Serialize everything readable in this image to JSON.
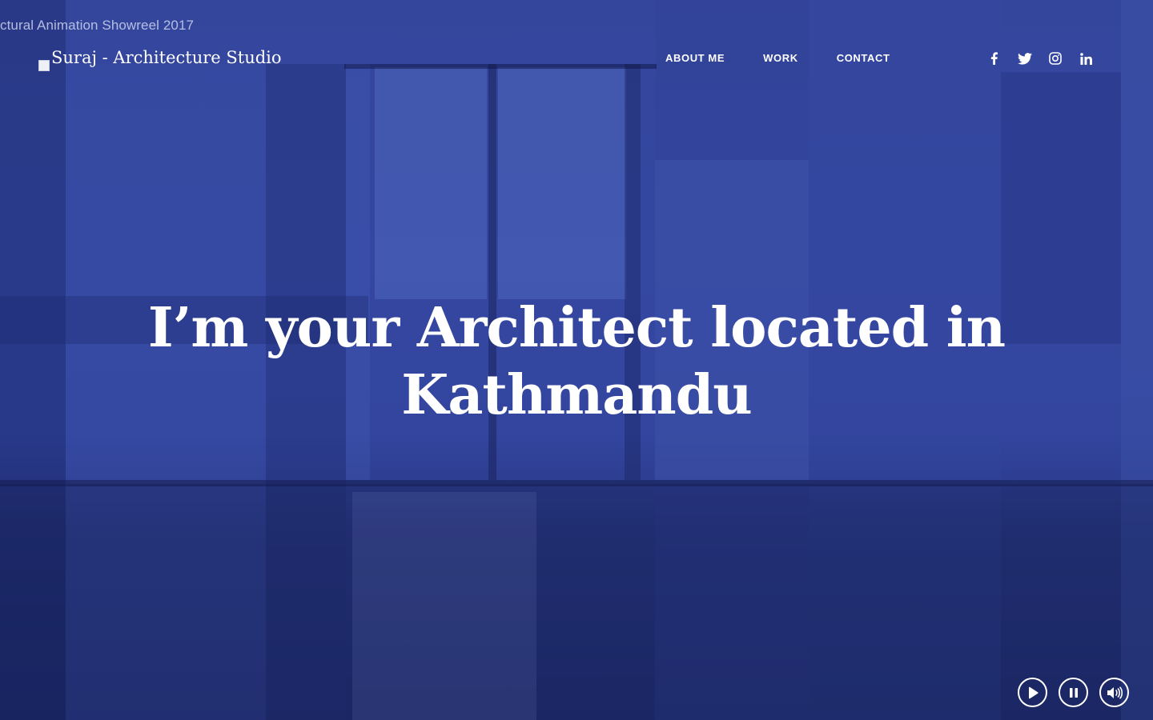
{
  "video": {
    "title": "ctural Animation Showreel 2017"
  },
  "header": {
    "logo_alt": "Suraj - Architecture Studio",
    "nav": [
      {
        "label": "ABOUT ME"
      },
      {
        "label": "WORK"
      },
      {
        "label": "CONTACT"
      }
    ],
    "social": [
      {
        "icon": "facebook-icon"
      },
      {
        "icon": "twitter-icon"
      },
      {
        "icon": "instagram-icon"
      },
      {
        "icon": "linkedin-icon"
      }
    ]
  },
  "hero": {
    "prefix": "I’m your ",
    "highlight": "Architect",
    "suffix": " located in",
    "line2": "Kathmandu"
  },
  "controls": {
    "buttons": [
      {
        "icon": "play-icon"
      },
      {
        "icon": "pause-icon"
      },
      {
        "icon": "volume-icon"
      }
    ]
  },
  "colors": {
    "background": "#3447a1",
    "text": "#ffffff",
    "highlight": "#aab4dc"
  }
}
